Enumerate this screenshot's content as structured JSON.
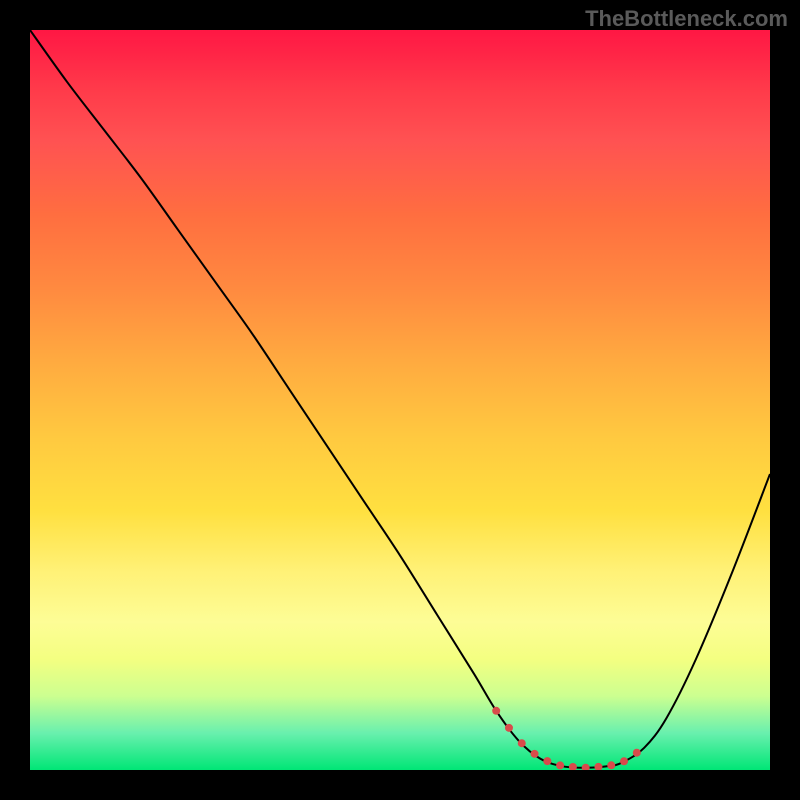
{
  "watermark": "TheBottleneck.com",
  "chart_data": {
    "type": "line",
    "title": "",
    "xlabel": "",
    "ylabel": "",
    "xlim": [
      0,
      100
    ],
    "ylim": [
      0,
      100
    ],
    "x": [
      0,
      5,
      10,
      15,
      20,
      25,
      30,
      35,
      40,
      45,
      50,
      55,
      60,
      63,
      66,
      69,
      72,
      75,
      78,
      80,
      83,
      86,
      90,
      95,
      100
    ],
    "values": [
      100,
      93,
      86.5,
      80,
      73,
      66,
      59,
      51.5,
      44,
      36.5,
      29,
      21,
      13,
      8,
      4,
      1.5,
      0.5,
      0.3,
      0.5,
      1,
      3,
      7,
      15,
      27,
      40
    ],
    "marker_region": {
      "x_range": [
        63,
        82
      ],
      "description": "dotted red markers along the curve minimum"
    },
    "background_gradient": {
      "top": "#ff1744",
      "bottom": "#00e676"
    }
  }
}
